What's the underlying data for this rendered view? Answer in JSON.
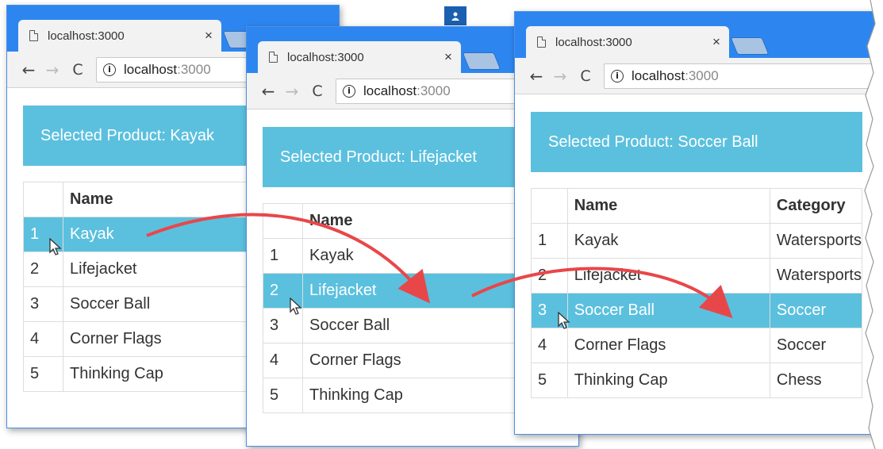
{
  "windows": [
    {
      "tab_title": "localhost:3000",
      "tab_close": "×",
      "url_host": "localhost",
      "url_port": ":3000",
      "banner": "Selected Product: Kayak",
      "headers": {
        "idx": "",
        "name": "Name"
      },
      "rows": [
        {
          "idx": "1",
          "name": "Kayak",
          "active": true
        },
        {
          "idx": "2",
          "name": "Lifejacket",
          "active": false
        },
        {
          "idx": "3",
          "name": "Soccer Ball",
          "active": false
        },
        {
          "idx": "4",
          "name": "Corner Flags",
          "active": false
        },
        {
          "idx": "5",
          "name": "Thinking Cap",
          "active": false
        }
      ]
    },
    {
      "tab_title": "localhost:3000",
      "tab_close": "×",
      "url_host": "localhost",
      "url_port": ":3000",
      "banner": "Selected Product: Lifejacket",
      "headers": {
        "idx": "",
        "name": "Name"
      },
      "rows": [
        {
          "idx": "1",
          "name": "Kayak",
          "active": false
        },
        {
          "idx": "2",
          "name": "Lifejacket",
          "active": true
        },
        {
          "idx": "3",
          "name": "Soccer Ball",
          "active": false
        },
        {
          "idx": "4",
          "name": "Corner Flags",
          "active": false
        },
        {
          "idx": "5",
          "name": "Thinking Cap",
          "active": false
        }
      ]
    },
    {
      "tab_title": "localhost:3000",
      "tab_close": "×",
      "url_host": "localhost",
      "url_port": ":3000",
      "banner": "Selected Product: Soccer Ball",
      "headers": {
        "idx": "",
        "name": "Name",
        "category": "Category"
      },
      "rows": [
        {
          "idx": "1",
          "name": "Kayak",
          "category": "Watersports",
          "active": false
        },
        {
          "idx": "2",
          "name": "Lifejacket",
          "category": "Watersports",
          "active": false
        },
        {
          "idx": "3",
          "name": "Soccer Ball",
          "category": "Soccer",
          "active": true
        },
        {
          "idx": "4",
          "name": "Corner Flags",
          "category": "Soccer",
          "active": false
        },
        {
          "idx": "5",
          "name": "Thinking Cap",
          "category": "Chess",
          "active": false
        }
      ]
    }
  ],
  "icons": {
    "back": "←",
    "forward": "→",
    "reload": "C",
    "info": "i"
  },
  "colors": {
    "titlebar": "#2d86f0",
    "selection": "#5bc0de",
    "arrow": "#e8474a"
  }
}
